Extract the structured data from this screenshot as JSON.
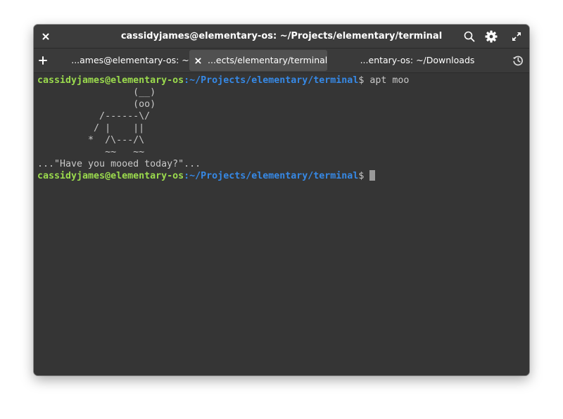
{
  "window": {
    "title": "cassidyjames@elementary-os: ~/Projects/elementary/terminal"
  },
  "tabs": [
    {
      "label": "...ames@elementary-os: ~",
      "active": false
    },
    {
      "label": "...ects/elementary/terminal",
      "active": true
    },
    {
      "label": "...entary-os: ~/Downloads",
      "active": false
    }
  ],
  "terminal": {
    "prompt_user": "cassidyjames@elementary-os",
    "prompt_sep": ":",
    "prompt_path": "~/Projects/elementary/terminal",
    "prompt_symbol": "$ ",
    "command": "apt moo",
    "output": [
      "                 (__)",
      "                 (oo)",
      "           /------\\/",
      "          / |    ||",
      "         *  /\\---/\\",
      "            ~~   ~~",
      "...\"Have you mooed today?\"..."
    ]
  },
  "icons": {
    "close": "close-icon",
    "search": "search-icon",
    "settings": "gear-icon",
    "maximize": "maximize-icon",
    "new_tab": "plus-icon",
    "history": "history-icon"
  },
  "colors": {
    "prompt_user": "#9bdb4d",
    "prompt_path": "#3689e6",
    "background": "#353535",
    "text": "#c8c8c8"
  }
}
